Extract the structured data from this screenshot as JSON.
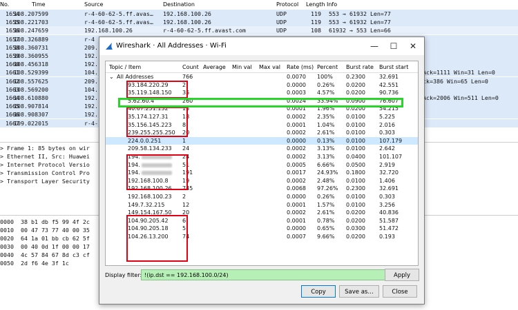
{
  "main_window": {
    "header": {
      "no": "No.",
      "time": "Time",
      "source": "Source",
      "destination": "Destination",
      "protocol": "Protocol",
      "length": "Length",
      "info": "Info"
    },
    "packets": [
      {
        "no": "1654",
        "time": "108.207599",
        "src": "r-4-60-62-5.ff.avas…",
        "dst": "192.168.100.26",
        "proto": "UDP",
        "len": "119",
        "info": "553 → 61932 Len=77",
        "extra": ""
      },
      {
        "no": "1655",
        "time": "108.221703",
        "src": "r-4-60-62-5.ff.avas…",
        "dst": "192.168.100.26",
        "proto": "UDP",
        "len": "119",
        "info": "553 → 61932 Len=77",
        "extra": ""
      },
      {
        "no": "1656",
        "time": "108.247659",
        "src": "192.168.100.26",
        "dst": "r-4-60-62-5.ff.avast.com",
        "proto": "UDP",
        "len": "108",
        "info": "61932 → 553 Len=66",
        "extra": ""
      },
      {
        "no": "1657",
        "time": "108.326889",
        "src": "r-4",
        "dst": "",
        "proto": "",
        "len": "",
        "info": "",
        "extra": ""
      },
      {
        "no": "1658",
        "time": "108.360731",
        "src": "209.",
        "dst": "",
        "proto": "",
        "len": "",
        "info": "",
        "extra": ""
      },
      {
        "no": "1659",
        "time": "108.360955",
        "src": "192.",
        "dst": "",
        "proto": "",
        "len": "",
        "info": "",
        "extra": ""
      },
      {
        "no": "1660",
        "time": "108.456318",
        "src": "192.",
        "dst": "",
        "proto": "",
        "len": "",
        "info": "",
        "extra": ""
      },
      {
        "no": "1661",
        "time": "108.529399",
        "src": "104.",
        "dst": "",
        "proto": "",
        "len": "",
        "info": "",
        "extra": "Ack=1111 Win=31 Len=0"
      },
      {
        "no": "1662",
        "time": "108.557625",
        "src": "209.",
        "dst": "",
        "proto": "",
        "len": "",
        "info": "",
        "extra": "ck=386 Win=65 Len=0"
      },
      {
        "no": "1663",
        "time": "108.569200",
        "src": "104.",
        "dst": "",
        "proto": "",
        "len": "",
        "info": "",
        "extra": ""
      },
      {
        "no": "1664",
        "time": "108.610880",
        "src": "192.",
        "dst": "",
        "proto": "",
        "len": "",
        "info": "",
        "extra": "Ack=2006 Win=511 Len=0"
      },
      {
        "no": "1665",
        "time": "108.907814",
        "src": "192.",
        "dst": "",
        "proto": "",
        "len": "",
        "info": "",
        "extra": ""
      },
      {
        "no": "1666",
        "time": "108.908307",
        "src": "192.",
        "dst": "",
        "proto": "",
        "len": "",
        "info": "",
        "extra": ""
      },
      {
        "no": "1667",
        "time": "109.022015",
        "src": "r-4-",
        "dst": "",
        "proto": "",
        "len": "",
        "info": "",
        "extra": ""
      }
    ],
    "details": [
      "> Frame 1: 85 bytes on wir",
      "> Ethernet II, Src: Huawei",
      "> Internet Protocol Versio",
      "> Transmission Control Pro",
      "> Transport Layer Security"
    ],
    "bytes": [
      "0000  38 b1 db f5 99 4f 2c",
      "0010  00 47 73 77 40 00 35",
      "0020  64 1a 01 bb cb 62 5f",
      "0030  00 40 0d 1f 00 00 17",
      "0040  4c 57 84 67 8d c3 cf",
      "0050  2d f6 4e 3f 1c"
    ]
  },
  "dialog": {
    "title": "Wireshark · All Addresses · Wi-Fi",
    "icons": {
      "app": "wireshark-fin-icon",
      "minimize": "minimize-icon",
      "maximize": "maximize-icon",
      "close": "close-icon"
    },
    "window_buttons": {
      "minimize": "—",
      "maximize": "☐",
      "close": "✕"
    },
    "columns": {
      "topic": "Topic / Item",
      "count": "Count",
      "average": "Average",
      "min": "Min val",
      "max": "Max val",
      "rate": "Rate (ms)",
      "percent": "Percent",
      "burst_rate": "Burst rate",
      "burst_start": "Burst start"
    },
    "tree_toggle": "⌄",
    "root": {
      "topic": "All Addresses",
      "count": "766",
      "rate": "0.0070",
      "percent": "100%",
      "burst_rate": "0.2300",
      "burst_start": "32.691"
    },
    "rows": [
      {
        "topic": "93.184.220.29",
        "count": "2",
        "rate": "0.0000",
        "percent": "0.26%",
        "burst_rate": "0.0200",
        "burst_start": "42.551",
        "blur": false
      },
      {
        "topic": "35.119.148.150",
        "count": "35",
        "rate": "0.0003",
        "percent": "4.57%",
        "burst_rate": "0.0200",
        "burst_start": "90.736",
        "blur": false
      },
      {
        "topic": "5.62.60.4",
        "count": "260",
        "rate": "0.0024",
        "percent": "33.94%",
        "burst_rate": "0.0900",
        "burst_start": "76.607",
        "blur": false
      },
      {
        "topic": "40.67.251.132",
        "count": "15",
        "rate": "0.0001",
        "percent": "1.96%",
        "burst_rate": "0.0200",
        "burst_start": "54.215",
        "blur": false
      },
      {
        "topic": "35.174.127.31",
        "count": "18",
        "rate": "0.0002",
        "percent": "2.35%",
        "burst_rate": "0.0100",
        "burst_start": "5.225",
        "blur": false
      },
      {
        "topic": "35.156.145.223",
        "count": "8",
        "rate": "0.0001",
        "percent": "1.04%",
        "burst_rate": "0.0100",
        "burst_start": "2.016",
        "blur": false
      },
      {
        "topic": "239.255.255.250",
        "count": "20",
        "rate": "0.0002",
        "percent": "2.61%",
        "burst_rate": "0.0100",
        "burst_start": "0.303",
        "blur": false
      },
      {
        "topic": "224.0.0.251",
        "count": "1",
        "rate": "0.0000",
        "percent": "0.13%",
        "burst_rate": "0.0100",
        "burst_start": "107.179",
        "blur": false
      },
      {
        "topic": "209.58.134.233",
        "count": "24",
        "rate": "0.0002",
        "percent": "3.13%",
        "burst_rate": "0.0100",
        "burst_start": "2.642",
        "blur": false
      },
      {
        "topic": "194.",
        "count": "24",
        "rate": "0.0002",
        "percent": "3.13%",
        "burst_rate": "0.0400",
        "burst_start": "101.107",
        "blur": true
      },
      {
        "topic": "194.",
        "count": "51",
        "rate": "0.0005",
        "percent": "6.66%",
        "burst_rate": "0.0500",
        "burst_start": "2.919",
        "blur": true
      },
      {
        "topic": "194.",
        "count": "191",
        "rate": "0.0017",
        "percent": "24.93%",
        "burst_rate": "0.1800",
        "burst_start": "32.720",
        "blur": true
      },
      {
        "topic": "192.168.100.8",
        "count": "19",
        "rate": "0.0002",
        "percent": "2.48%",
        "burst_rate": "0.0100",
        "burst_start": "1.406",
        "blur": false
      },
      {
        "topic": "192.168.100.26",
        "count": "745",
        "rate": "0.0068",
        "percent": "97.26%",
        "burst_rate": "0.2300",
        "burst_start": "32.691",
        "blur": false
      },
      {
        "topic": "192.168.100.23",
        "count": "2",
        "rate": "0.0000",
        "percent": "0.26%",
        "burst_rate": "0.0100",
        "burst_start": "0.303",
        "blur": false
      },
      {
        "topic": "149.7.32.215",
        "count": "12",
        "rate": "0.0001",
        "percent": "1.57%",
        "burst_rate": "0.0100",
        "burst_start": "3.256",
        "blur": false
      },
      {
        "topic": "149.154.167.50",
        "count": "20",
        "rate": "0.0002",
        "percent": "2.61%",
        "burst_rate": "0.0200",
        "burst_start": "40.836",
        "blur": false
      },
      {
        "topic": "104.90.205.42",
        "count": "6",
        "rate": "0.0001",
        "percent": "0.78%",
        "burst_rate": "0.0200",
        "burst_start": "51.587",
        "blur": false
      },
      {
        "topic": "104.90.205.18",
        "count": "5",
        "rate": "0.0000",
        "percent": "0.65%",
        "burst_rate": "0.0300",
        "burst_start": "51.472",
        "blur": false
      },
      {
        "topic": "104.26.13.200",
        "count": "74",
        "rate": "0.0007",
        "percent": "9.66%",
        "burst_rate": "0.0200",
        "burst_start": "0.193",
        "blur": false
      }
    ],
    "filter_label": "Display filter:",
    "filter_value": "!(ip.dst == 192.168.100.0/24)",
    "buttons": {
      "apply": "Apply",
      "copy": "Copy",
      "save_as": "Save as…",
      "close": "Close"
    }
  },
  "colors": {
    "annotation_red": "#e0000f",
    "annotation_green": "#29d42b",
    "filter_valid_bg": "#b7f0b7",
    "packet_row_blue": "#dce9f9",
    "selected_row": "#cde8ff"
  }
}
